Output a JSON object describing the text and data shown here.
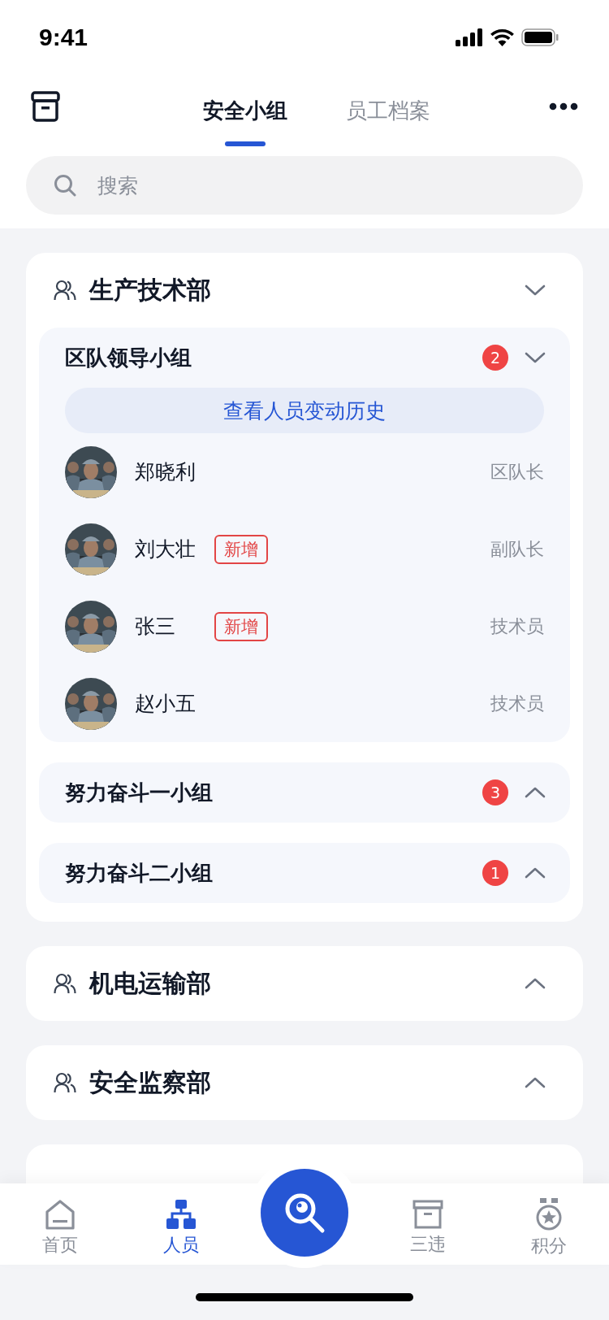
{
  "status_bar": {
    "time": "9:41"
  },
  "tabs": [
    {
      "label": "安全小组",
      "selected": true
    },
    {
      "label": "员工档案",
      "selected": false
    }
  ],
  "search": {
    "placeholder": "搜索"
  },
  "departments": [
    {
      "name": "生产技术部",
      "expanded": true,
      "groups": [
        {
          "name": "区队领导小组",
          "count": "2",
          "expanded": true,
          "history_button": "查看人员变动历史",
          "members": [
            {
              "name": "郑晓利",
              "is_new": false,
              "role": "区队长"
            },
            {
              "name": "刘大壮",
              "is_new": true,
              "new_label": "新增",
              "role": "副队长"
            },
            {
              "name": "张三",
              "is_new": true,
              "new_label": "新增",
              "role": "技术员"
            },
            {
              "name": "赵小五",
              "is_new": false,
              "role": "技术员"
            }
          ]
        },
        {
          "name": "努力奋斗一小组",
          "count": "3",
          "expanded": false
        },
        {
          "name": "努力奋斗二小组",
          "count": "1",
          "expanded": false
        }
      ]
    },
    {
      "name": "机电运输部",
      "expanded": false
    },
    {
      "name": "安全监察部",
      "expanded": false
    }
  ],
  "bottom_nav": [
    {
      "kind": "home",
      "label": "首页",
      "selected": false
    },
    {
      "kind": "people",
      "label": "人员",
      "selected": true
    },
    {
      "kind": "scan",
      "selected": false
    },
    {
      "kind": "archive",
      "label": "三违",
      "selected": false
    },
    {
      "kind": "medal",
      "label": "积分",
      "selected": false
    }
  ]
}
